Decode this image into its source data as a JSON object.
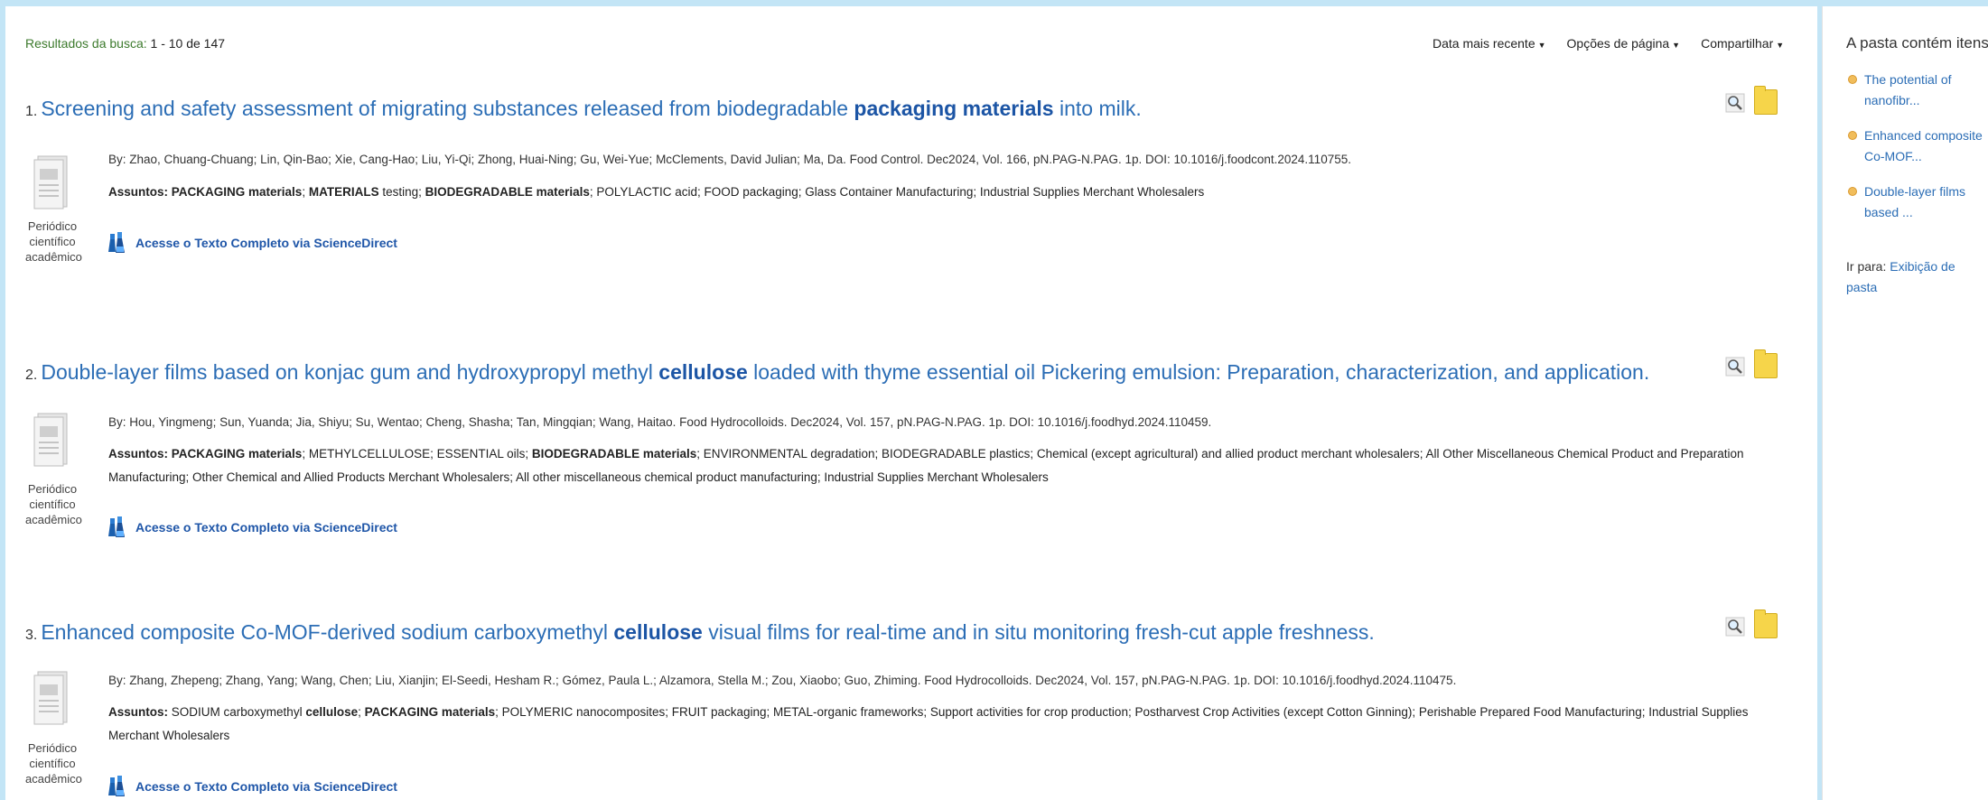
{
  "header": {
    "results_label": "Resultados da busca:",
    "results_count": "1 - 10 de 147",
    "sort": "Data mais recente",
    "page_options": "Opções de página",
    "share": "Compartilhar"
  },
  "records": [
    {
      "number": "1.",
      "title_parts": [
        "Screening and safety assessment of migrating substances released from biodegradable ",
        "packaging materials",
        " into milk."
      ],
      "byline": "By: Zhao, Chuang-Chuang; Lin, Qin-Bao; Xie, Cang-Hao; Liu, Yi-Qi; Zhong, Huai-Ning; Gu, Wei-Yue; McClements, David Julian; Ma, Da. Food Control. Dec2024, Vol. 166, pN.PAG-N.PAG. 1p. DOI: 10.1016/j.foodcont.2024.110755.",
      "subjects_label": "Assuntos:",
      "subjects": [
        {
          "text": "PACKAGING materials",
          "bold": true
        },
        {
          "text": "; ",
          "bold": false
        },
        {
          "text": "MATERIALS",
          "bold": true
        },
        {
          "text": " testing; ",
          "bold": false
        },
        {
          "text": "BIODEGRADABLE materials",
          "bold": true
        },
        {
          "text": "; POLYLACTIC acid; FOOD packaging; Glass Container Manufacturing; Industrial Supplies Merchant Wholesalers",
          "bold": false
        }
      ],
      "pub_type": "Periódico científico acadêmico",
      "fulltext_link": "Acesse o Texto Completo via ScienceDirect"
    },
    {
      "number": "2.",
      "title_parts": [
        "Double-layer films based on konjac gum and hydroxypropyl methyl ",
        "cellulose",
        " loaded with thyme essential oil Pickering emulsion: Preparation, characterization, and application."
      ],
      "byline": "By: Hou, Yingmeng; Sun, Yuanda; Jia, Shiyu; Su, Wentao; Cheng, Shasha; Tan, Mingqian; Wang, Haitao. Food Hydrocolloids. Dec2024, Vol. 157, pN.PAG-N.PAG. 1p. DOI: 10.1016/j.foodhyd.2024.110459.",
      "subjects_label": "Assuntos:",
      "subjects": [
        {
          "text": "PACKAGING materials",
          "bold": true
        },
        {
          "text": "; METHYLCELLULOSE; ESSENTIAL oils; ",
          "bold": false
        },
        {
          "text": "BIODEGRADABLE materials",
          "bold": true
        },
        {
          "text": "; ENVIRONMENTAL degradation; BIODEGRADABLE plastics; Chemical (except agricultural) and allied product merchant wholesalers; All Other Miscellaneous Chemical Product and Preparation Manufacturing; Other Chemical and Allied Products Merchant Wholesalers; All other miscellaneous chemical product manufacturing; Industrial Supplies Merchant Wholesalers",
          "bold": false
        }
      ],
      "pub_type": "Periódico científico acadêmico",
      "fulltext_link": "Acesse o Texto Completo via ScienceDirect"
    },
    {
      "number": "3.",
      "title_parts": [
        "Enhanced composite Co-MOF-derived sodium carboxymethyl ",
        "cellulose",
        " visual films for real-time and in situ monitoring fresh-cut apple freshness."
      ],
      "byline": "By: Zhang, Zhepeng; Zhang, Yang; Wang, Chen; Liu, Xianjin; El-Seedi, Hesham R.; Gómez, Paula L.; Alzamora, Stella M.; Zou, Xiaobo; Guo, Zhiming. Food Hydrocolloids. Dec2024, Vol. 157, pN.PAG-N.PAG. 1p. DOI: 10.1016/j.foodhyd.2024.110475.",
      "subjects_label": "Assuntos:",
      "subjects": [
        {
          "text": "SODIUM carboxymethyl ",
          "bold": false
        },
        {
          "text": "cellulose",
          "bold": true
        },
        {
          "text": "; ",
          "bold": false
        },
        {
          "text": "PACKAGING materials",
          "bold": true
        },
        {
          "text": "; POLYMERIC nanocomposites; FRUIT packaging; METAL-organic frameworks; Support activities for crop production; Postharvest Crop Activities (except Cotton Ginning); Perishable Prepared Food Manufacturing; Industrial Supplies Merchant Wholesalers",
          "bold": false
        }
      ],
      "pub_type": "Periódico científico acadêmico",
      "fulltext_link": "Acesse o Texto Completo via ScienceDirect"
    }
  ],
  "sidebar": {
    "title": "A pasta contém itens",
    "items": [
      {
        "label": "The potential of nanofibr..."
      },
      {
        "label": "Enhanced composite Co-MOF..."
      },
      {
        "label": "Double-layer films based ..."
      }
    ],
    "goto_label": "Ir para:",
    "goto_link": "Exibição de pasta"
  },
  "icons": {
    "preview": "magnifier-icon",
    "folder": "folder-icon",
    "document": "document-icon",
    "fulltext": "flask-icon",
    "bullet": "bullet-icon"
  },
  "colors": {
    "page_bg": "#c3e5f6",
    "link": "#2b6db5",
    "results_label": "#3c7a2c",
    "folder": "#f6d54a"
  }
}
